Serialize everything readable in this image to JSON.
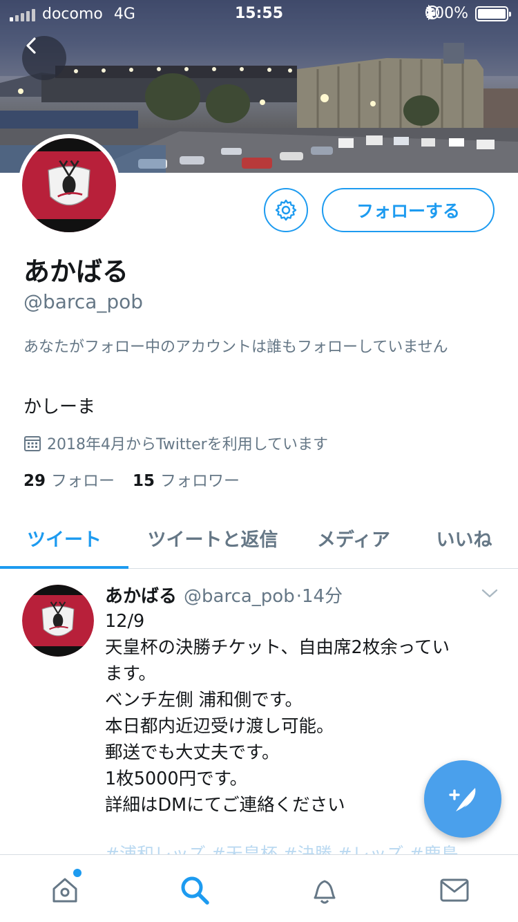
{
  "status_bar": {
    "carrier": "docomo",
    "network": "4G",
    "time": "15:55",
    "battery": "100%"
  },
  "profile": {
    "display_name": "あかばる",
    "handle": "@barca_pob",
    "follow_button": "フォローする",
    "follow_context": "あなたがフォロー中のアカウントは誰もフォローしていません",
    "bio": "かしーま",
    "joined": "2018年4月からTwitterを利用しています",
    "following_count": "29",
    "following_label": "フォロー",
    "followers_count": "15",
    "followers_label": "フォロワー"
  },
  "tabs": [
    {
      "label": "ツイート",
      "active": true
    },
    {
      "label": "ツイートと返信",
      "active": false
    },
    {
      "label": "メディア",
      "active": false
    },
    {
      "label": "いいね",
      "active": false
    }
  ],
  "tweet": {
    "name": "あかばる",
    "handle": "@barca_pob",
    "separator": "·",
    "time": "14分",
    "lines": [
      "12/9",
      "天皇杯の決勝チケット、自由席2枚余ってい",
      "ます。",
      "ベンチ左側 浦和側です。",
      "本日都内近辺受け渡し可能。",
      "郵送でも大丈夫です。",
      "1枚5000円です。",
      "詳細はDMにてご連絡ください"
    ],
    "faded_next_line": "#浦和レッズ #天皇杯 #決勝 #レッズ #鹿島"
  },
  "icons": {
    "back": "chevron-left-icon",
    "settings": "gear-icon",
    "calendar": "calendar-icon",
    "caret": "chevron-down-icon",
    "compose": "compose-feather-icon",
    "nav": [
      "home-icon",
      "search-icon",
      "notifications-icon",
      "messages-icon"
    ]
  },
  "colors": {
    "accent": "#1d9bf0",
    "secondary_text": "#657786",
    "fab": "#4aa0ec",
    "club_red": "#b8203a"
  }
}
